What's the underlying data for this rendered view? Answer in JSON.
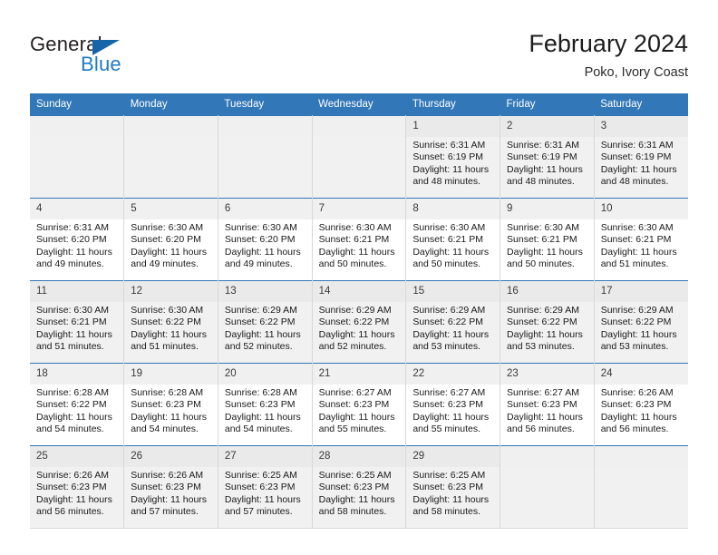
{
  "brand": {
    "name_part1": "General",
    "name_part2": "Blue",
    "triangle_icon": "triangle-icon",
    "accent_color": "#1f7ac0"
  },
  "header": {
    "month_title": "February 2024",
    "location": "Poko, Ivory Coast",
    "header_bg_color": "#3277b8"
  },
  "calendar": {
    "weekday_headers": [
      "Sunday",
      "Monday",
      "Tuesday",
      "Wednesday",
      "Thursday",
      "Friday",
      "Saturday"
    ],
    "labels": {
      "sunrise_prefix": "Sunrise:",
      "sunset_prefix": "Sunset:",
      "daylight_prefix": "Daylight:"
    },
    "weeks": [
      [
        {
          "day": "",
          "empty": true
        },
        {
          "day": "",
          "empty": true
        },
        {
          "day": "",
          "empty": true
        },
        {
          "day": "",
          "empty": true
        },
        {
          "day": "1",
          "sunrise": "Sunrise: 6:31 AM",
          "sunset": "Sunset: 6:19 PM",
          "daylight_line1": "Daylight: 11 hours",
          "daylight_line2": "and 48 minutes."
        },
        {
          "day": "2",
          "sunrise": "Sunrise: 6:31 AM",
          "sunset": "Sunset: 6:19 PM",
          "daylight_line1": "Daylight: 11 hours",
          "daylight_line2": "and 48 minutes."
        },
        {
          "day": "3",
          "sunrise": "Sunrise: 6:31 AM",
          "sunset": "Sunset: 6:19 PM",
          "daylight_line1": "Daylight: 11 hours",
          "daylight_line2": "and 48 minutes."
        }
      ],
      [
        {
          "day": "4",
          "sunrise": "Sunrise: 6:31 AM",
          "sunset": "Sunset: 6:20 PM",
          "daylight_line1": "Daylight: 11 hours",
          "daylight_line2": "and 49 minutes."
        },
        {
          "day": "5",
          "sunrise": "Sunrise: 6:30 AM",
          "sunset": "Sunset: 6:20 PM",
          "daylight_line1": "Daylight: 11 hours",
          "daylight_line2": "and 49 minutes."
        },
        {
          "day": "6",
          "sunrise": "Sunrise: 6:30 AM",
          "sunset": "Sunset: 6:20 PM",
          "daylight_line1": "Daylight: 11 hours",
          "daylight_line2": "and 49 minutes."
        },
        {
          "day": "7",
          "sunrise": "Sunrise: 6:30 AM",
          "sunset": "Sunset: 6:21 PM",
          "daylight_line1": "Daylight: 11 hours",
          "daylight_line2": "and 50 minutes."
        },
        {
          "day": "8",
          "sunrise": "Sunrise: 6:30 AM",
          "sunset": "Sunset: 6:21 PM",
          "daylight_line1": "Daylight: 11 hours",
          "daylight_line2": "and 50 minutes."
        },
        {
          "day": "9",
          "sunrise": "Sunrise: 6:30 AM",
          "sunset": "Sunset: 6:21 PM",
          "daylight_line1": "Daylight: 11 hours",
          "daylight_line2": "and 50 minutes."
        },
        {
          "day": "10",
          "sunrise": "Sunrise: 6:30 AM",
          "sunset": "Sunset: 6:21 PM",
          "daylight_line1": "Daylight: 11 hours",
          "daylight_line2": "and 51 minutes."
        }
      ],
      [
        {
          "day": "11",
          "sunrise": "Sunrise: 6:30 AM",
          "sunset": "Sunset: 6:21 PM",
          "daylight_line1": "Daylight: 11 hours",
          "daylight_line2": "and 51 minutes."
        },
        {
          "day": "12",
          "sunrise": "Sunrise: 6:30 AM",
          "sunset": "Sunset: 6:22 PM",
          "daylight_line1": "Daylight: 11 hours",
          "daylight_line2": "and 51 minutes."
        },
        {
          "day": "13",
          "sunrise": "Sunrise: 6:29 AM",
          "sunset": "Sunset: 6:22 PM",
          "daylight_line1": "Daylight: 11 hours",
          "daylight_line2": "and 52 minutes."
        },
        {
          "day": "14",
          "sunrise": "Sunrise: 6:29 AM",
          "sunset": "Sunset: 6:22 PM",
          "daylight_line1": "Daylight: 11 hours",
          "daylight_line2": "and 52 minutes."
        },
        {
          "day": "15",
          "sunrise": "Sunrise: 6:29 AM",
          "sunset": "Sunset: 6:22 PM",
          "daylight_line1": "Daylight: 11 hours",
          "daylight_line2": "and 53 minutes."
        },
        {
          "day": "16",
          "sunrise": "Sunrise: 6:29 AM",
          "sunset": "Sunset: 6:22 PM",
          "daylight_line1": "Daylight: 11 hours",
          "daylight_line2": "and 53 minutes."
        },
        {
          "day": "17",
          "sunrise": "Sunrise: 6:29 AM",
          "sunset": "Sunset: 6:22 PM",
          "daylight_line1": "Daylight: 11 hours",
          "daylight_line2": "and 53 minutes."
        }
      ],
      [
        {
          "day": "18",
          "sunrise": "Sunrise: 6:28 AM",
          "sunset": "Sunset: 6:22 PM",
          "daylight_line1": "Daylight: 11 hours",
          "daylight_line2": "and 54 minutes."
        },
        {
          "day": "19",
          "sunrise": "Sunrise: 6:28 AM",
          "sunset": "Sunset: 6:23 PM",
          "daylight_line1": "Daylight: 11 hours",
          "daylight_line2": "and 54 minutes."
        },
        {
          "day": "20",
          "sunrise": "Sunrise: 6:28 AM",
          "sunset": "Sunset: 6:23 PM",
          "daylight_line1": "Daylight: 11 hours",
          "daylight_line2": "and 54 minutes."
        },
        {
          "day": "21",
          "sunrise": "Sunrise: 6:27 AM",
          "sunset": "Sunset: 6:23 PM",
          "daylight_line1": "Daylight: 11 hours",
          "daylight_line2": "and 55 minutes."
        },
        {
          "day": "22",
          "sunrise": "Sunrise: 6:27 AM",
          "sunset": "Sunset: 6:23 PM",
          "daylight_line1": "Daylight: 11 hours",
          "daylight_line2": "and 55 minutes."
        },
        {
          "day": "23",
          "sunrise": "Sunrise: 6:27 AM",
          "sunset": "Sunset: 6:23 PM",
          "daylight_line1": "Daylight: 11 hours",
          "daylight_line2": "and 56 minutes."
        },
        {
          "day": "24",
          "sunrise": "Sunrise: 6:26 AM",
          "sunset": "Sunset: 6:23 PM",
          "daylight_line1": "Daylight: 11 hours",
          "daylight_line2": "and 56 minutes."
        }
      ],
      [
        {
          "day": "25",
          "sunrise": "Sunrise: 6:26 AM",
          "sunset": "Sunset: 6:23 PM",
          "daylight_line1": "Daylight: 11 hours",
          "daylight_line2": "and 56 minutes."
        },
        {
          "day": "26",
          "sunrise": "Sunrise: 6:26 AM",
          "sunset": "Sunset: 6:23 PM",
          "daylight_line1": "Daylight: 11 hours",
          "daylight_line2": "and 57 minutes."
        },
        {
          "day": "27",
          "sunrise": "Sunrise: 6:25 AM",
          "sunset": "Sunset: 6:23 PM",
          "daylight_line1": "Daylight: 11 hours",
          "daylight_line2": "and 57 minutes."
        },
        {
          "day": "28",
          "sunrise": "Sunrise: 6:25 AM",
          "sunset": "Sunset: 6:23 PM",
          "daylight_line1": "Daylight: 11 hours",
          "daylight_line2": "and 58 minutes."
        },
        {
          "day": "29",
          "sunrise": "Sunrise: 6:25 AM",
          "sunset": "Sunset: 6:23 PM",
          "daylight_line1": "Daylight: 11 hours",
          "daylight_line2": "and 58 minutes."
        },
        {
          "day": "",
          "empty": true
        },
        {
          "day": "",
          "empty": true
        }
      ]
    ]
  }
}
